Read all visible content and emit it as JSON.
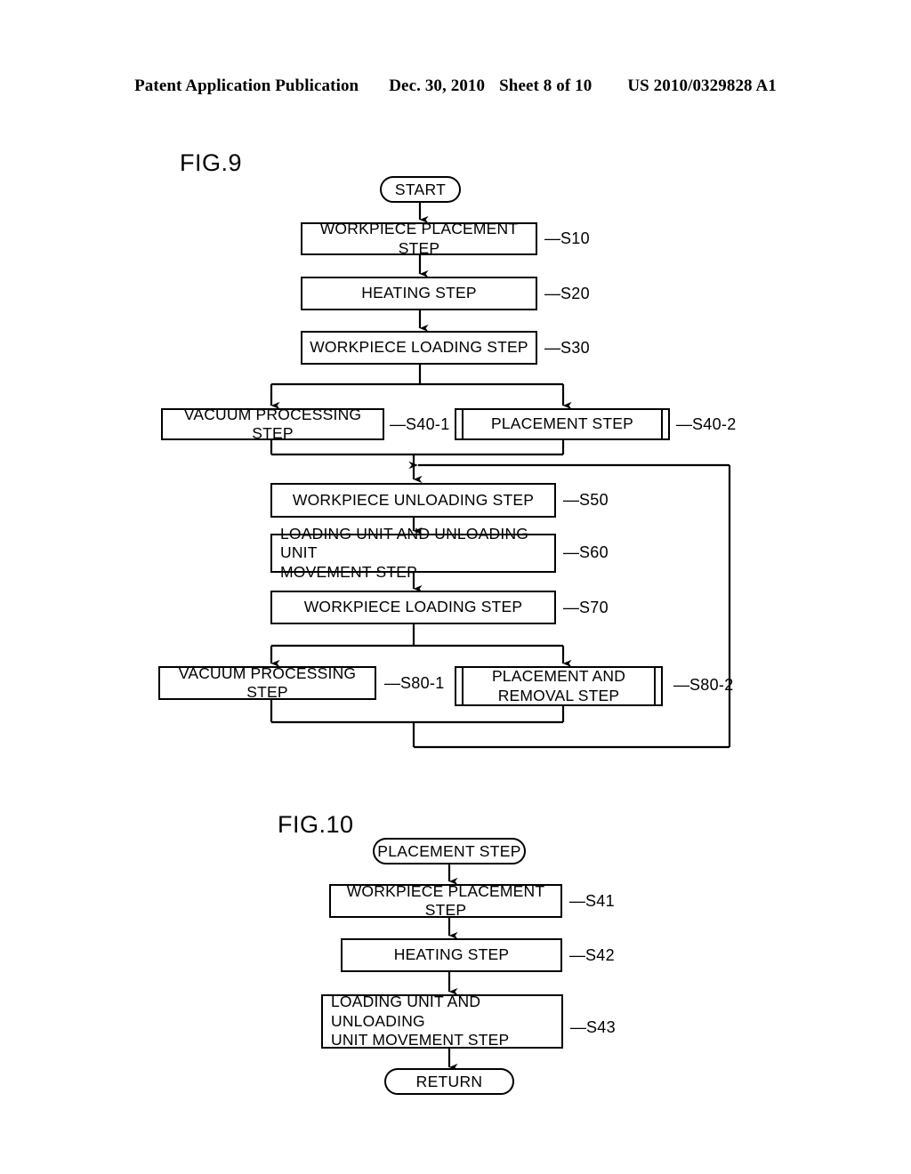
{
  "header": {
    "publication": "Patent Application Publication",
    "date": "Dec. 30, 2010",
    "sheet": "Sheet 8 of 10",
    "doc_number": "US 2010/0329828 A1"
  },
  "figures": [
    {
      "id": "fig9",
      "label": "FIG.9",
      "nodes": {
        "start": {
          "text": "START",
          "shape": "terminator"
        },
        "s10": {
          "text": "WORKPIECE PLACEMENT STEP",
          "ref": "S10",
          "shape": "process"
        },
        "s20": {
          "text": "HEATING STEP",
          "ref": "S20",
          "shape": "process"
        },
        "s30": {
          "text": "WORKPIECE LOADING STEP",
          "ref": "S30",
          "shape": "process"
        },
        "s40_1": {
          "text": "VACUUM PROCESSING STEP",
          "ref": "S40-1",
          "shape": "process"
        },
        "s40_2": {
          "text": "PLACEMENT STEP",
          "ref": "S40-2",
          "shape": "subroutine"
        },
        "s50": {
          "text": "WORKPIECE UNLOADING STEP",
          "ref": "S50",
          "shape": "process"
        },
        "s60": {
          "text": "LOADING UNIT AND UNLOADING UNIT\nMOVEMENT STEP",
          "ref": "S60",
          "shape": "process"
        },
        "s70": {
          "text": "WORKPIECE LOADING STEP",
          "ref": "S70",
          "shape": "process"
        },
        "s80_1": {
          "text": "VACUUM PROCESSING STEP",
          "ref": "S80-1",
          "shape": "process"
        },
        "s80_2": {
          "text": "PLACEMENT AND\nREMOVAL STEP",
          "ref": "S80-2",
          "shape": "subroutine"
        }
      }
    },
    {
      "id": "fig10",
      "label": "FIG.10",
      "nodes": {
        "entry": {
          "text": "PLACEMENT STEP",
          "shape": "terminator"
        },
        "s41": {
          "text": "WORKPIECE PLACEMENT STEP",
          "ref": "S41",
          "shape": "process"
        },
        "s42": {
          "text": "HEATING STEP",
          "ref": "S42",
          "shape": "process"
        },
        "s43": {
          "text": "LOADING UNIT AND UNLOADING\nUNIT MOVEMENT STEP",
          "ref": "S43",
          "shape": "process"
        },
        "return": {
          "text": "RETURN",
          "shape": "terminator"
        }
      }
    }
  ],
  "colors": {
    "ink": "#000000",
    "paper": "#ffffff"
  }
}
